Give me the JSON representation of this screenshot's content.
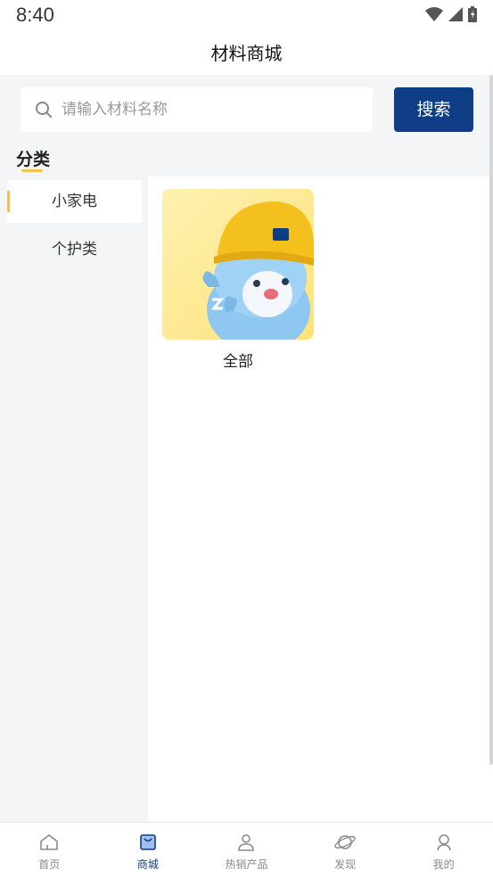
{
  "status_bar": {
    "time": "8:40"
  },
  "header": {
    "title": "材料商城"
  },
  "search": {
    "placeholder": "请输入材料名称",
    "button_label": "搜索"
  },
  "category": {
    "title": "分类",
    "items": [
      {
        "label": "小家电",
        "active": true
      },
      {
        "label": "个护类",
        "active": false
      }
    ]
  },
  "products": [
    {
      "label": "全部",
      "image": "mascot-hardhat"
    }
  ],
  "tabs": [
    {
      "label": "首页",
      "icon": "home-icon",
      "active": false
    },
    {
      "label": "商城",
      "icon": "shop-bag-icon",
      "active": true
    },
    {
      "label": "热销产品",
      "icon": "person-icon",
      "active": false
    },
    {
      "label": "发现",
      "icon": "planet-icon",
      "active": false
    },
    {
      "label": "我的",
      "icon": "user-icon",
      "active": false
    }
  ],
  "colors": {
    "accent": "#0f3e86",
    "highlight": "#f4c24a",
    "background": "#f4f5f7"
  }
}
